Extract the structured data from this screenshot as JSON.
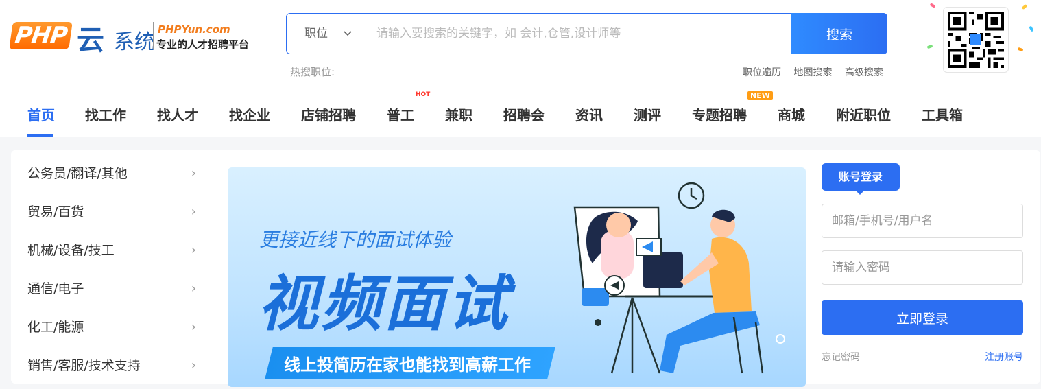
{
  "logo": {
    "php": "PHP",
    "yun": "云",
    "sys": "系统",
    "brand": "PHPYun.com",
    "slogan": "专业的人才招聘平台"
  },
  "search": {
    "type_label": "职位",
    "placeholder": "请输入要搜索的关键字，如 会计,仓管,设计师等",
    "button_label": "搜索",
    "hot_label": "热搜职位:",
    "links": [
      "职位遍历",
      "地图搜索",
      "高级搜索"
    ]
  },
  "nav": {
    "items": [
      "首页",
      "找工作",
      "找人才",
      "找企业",
      "店铺招聘",
      "普工",
      "兼职",
      "招聘会",
      "资讯",
      "测评",
      "专题招聘",
      "商城",
      "附近职位",
      "工具箱"
    ],
    "hot_badge": "HOT",
    "new_badge": "NEW"
  },
  "categories": [
    "公务员/翻译/其他",
    "贸易/百货",
    "机械/设备/技工",
    "通信/电子",
    "化工/能源",
    "销售/客服/技术支持"
  ],
  "banner": {
    "subtitle": "更接近线下的面试体验",
    "title": "视频面试",
    "ribbon": "线上投简历在家也能找到高薪工作"
  },
  "login": {
    "tab_label": "账号登录",
    "username_placeholder": "邮箱/手机号/用户名",
    "password_placeholder": "请输入密码",
    "submit_label": "立即登录",
    "forgot_label": "忘记密码",
    "register_label": "注册账号"
  },
  "colors": {
    "accent": "#2c6ef2",
    "brand_orange": "#ff7a00"
  }
}
